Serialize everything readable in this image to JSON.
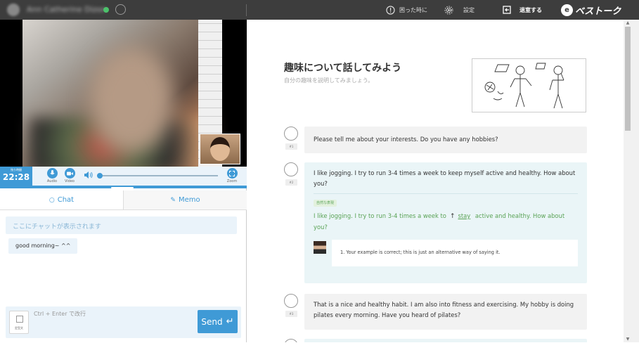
{
  "topbar": {
    "tutor_name": "Ann Catherine Dizon",
    "help_label": "困った時に",
    "settings_label": "設定",
    "exit_label": "退室する",
    "brand_name": "ベストーク"
  },
  "video": {
    "timer_label": "残り時間",
    "timer": "22:28",
    "audio_label": "Audio",
    "video_label": "Video",
    "zoom_label": "Zoom"
  },
  "tabs": {
    "chat": "Chat",
    "memo": "Memo"
  },
  "chat": {
    "placeholder": "ここにチャットが表示されます",
    "messages": [
      "good morning~ ^^"
    ],
    "input_placeholder": "Ctrl + Enter で改行",
    "stamp_label": "定型文",
    "send_label": "Send"
  },
  "lesson": {
    "title": "趣味について話してみよう",
    "subtitle": "自分の趣味を説明してみましょう。",
    "turns": [
      {
        "num": "#1",
        "text": "Please tell me about your interests. Do you have any hobbies?"
      },
      {
        "num": "#2",
        "text": "I like jogging. I try to run 3-4 times a week to keep myself active and healthy. How about you?",
        "tag": "自然な表現",
        "corrected_before": "I like jogging. I try to run 3-4 times a week to",
        "corrected_insert": "stay",
        "corrected_after": "active and healthy. How about you?",
        "note": "1. Your example is correct; this is just an alternative way of saying it."
      },
      {
        "num": "#3",
        "text": "That is a nice and healthy habit. I am also into fitness and exercising. My hobby is doing pilates every morning. Have you heard of pilates?"
      }
    ]
  },
  "colors": {
    "accent": "#3f9ad6",
    "topbar": "#3d3d3d",
    "correction_green": "#5aa356"
  }
}
